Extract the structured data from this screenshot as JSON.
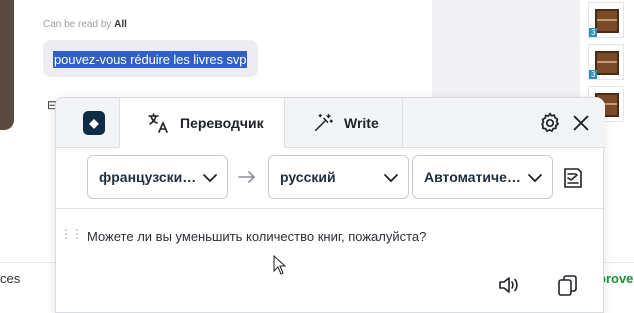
{
  "chat": {
    "can_read_prefix": "Can be read by",
    "can_read_who": "All",
    "message": "pouvez-vous réduire les livres svp"
  },
  "background": {
    "left_fragment": "ces",
    "right_fragment": "prove",
    "thumb_labels": [
      "3",
      "3",
      "3"
    ]
  },
  "translator": {
    "tabs": {
      "translator": "Переводчик",
      "write": "Write"
    },
    "source_language": "французски…",
    "target_language": "русский",
    "style_option": "Автоматиче…",
    "translated_text": "Можете ли вы уменьшить количество книг, пожалуйста?",
    "icons": {
      "logo": "deepl-logo-icon",
      "translate": "translate-icon",
      "write": "magic-wand-icon",
      "settings": "gear-icon",
      "close": "close-icon",
      "swap": "arrow-right-icon",
      "glossary": "glossary-icon",
      "listen": "speaker-icon",
      "copy": "copy-icon"
    }
  },
  "colors": {
    "selection": "#2f5fc7",
    "accent_green": "#1f8f35",
    "logo_bg": "#0f2b46"
  }
}
